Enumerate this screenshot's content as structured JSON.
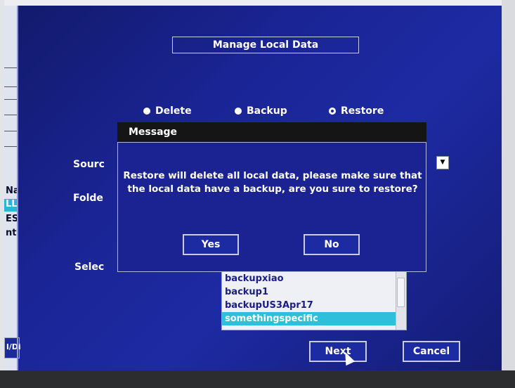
{
  "header": {
    "title": "Manage Local Data"
  },
  "mode": {
    "options": [
      {
        "label": "Delete",
        "selected": false
      },
      {
        "label": "Backup",
        "selected": false
      },
      {
        "label": "Restore",
        "selected": true
      }
    ]
  },
  "form": {
    "source_label": "Sourc",
    "folder_label": "Folde",
    "select_label": "Selec"
  },
  "background_list": {
    "rows": [
      "Na",
      "LL",
      "ES",
      "nt"
    ],
    "side_label": "l/Di"
  },
  "backups": {
    "items": [
      "backupxiao",
      "backup1",
      "backupUS3Apr17",
      "somethingspecific"
    ],
    "selected_index": 3
  },
  "buttons": {
    "next": "Next",
    "cancel": "Cancel"
  },
  "dialog": {
    "title": "Message",
    "message_line1": "Restore will delete all local data, please make sure that",
    "message_line2": "the local data have a backup, are you sure to restore?",
    "yes": "Yes",
    "no": "No"
  }
}
